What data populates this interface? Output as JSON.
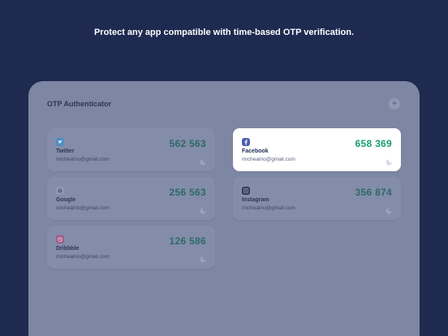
{
  "headline": "Protect any app compatible with time-based OTP verification.",
  "app": {
    "title": "OTP Authenticator",
    "add_label": "+"
  },
  "colors": {
    "background": "#1e2a50",
    "accent_code": "#1a9b75",
    "twitter": "#1da1f2",
    "facebook": "#3b5998",
    "dribbble": "#ea4c89"
  },
  "accounts": [
    {
      "service": "Twitter",
      "email": "michealrio@gmail.com",
      "code": "562 563",
      "icon": "twitter-icon",
      "selected": false
    },
    {
      "service": "Facebook",
      "email": "michealrio@gmail.com",
      "code": "658 369",
      "icon": "facebook-icon",
      "selected": true
    },
    {
      "service": "Google",
      "email": "michealrio@gmail.com",
      "code": "256 563",
      "icon": "google-icon",
      "selected": false
    },
    {
      "service": "Instagram",
      "email": "michealrio@gmail.com",
      "code": "356 874",
      "icon": "instagram-icon",
      "selected": false
    },
    {
      "service": "Dribbble",
      "email": "michealrio@gmail.com",
      "code": "126 586",
      "icon": "dribbble-icon",
      "selected": false
    }
  ]
}
